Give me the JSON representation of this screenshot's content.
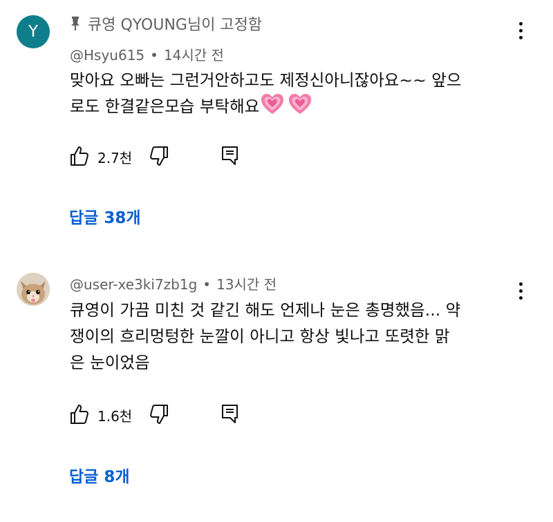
{
  "comments": [
    {
      "avatar_letter": "Y",
      "avatar_color": "#0f7e8c",
      "pinned_label": "큐영 QYOUNG님이 고정함",
      "author": "@Hsyu615",
      "separator": "•",
      "time": "14시간 전",
      "text_lines": [
        "맞아요 오빠는 그런거안하고도 제정신아니잖아요~~ 앞으",
        "로도 한결같은모습 부탁해요"
      ],
      "emoji": [
        "growing-heart",
        "growing-heart"
      ],
      "like_count": "2.7천",
      "replies_label": "답글 38개"
    },
    {
      "avatar_icon": "cat-photo-avatar",
      "author": "@user-xe3ki7zb1g",
      "separator": "•",
      "time": "13시간 전",
      "text_lines": [
        "큐영이 가끔 미친 것 같긴 해도 언제나 눈은 총명했음... 약",
        "쟁이의 흐리멍텅한 눈깔이 아니고 항상 빛나고 또렷한 맑",
        "은 눈이었음"
      ],
      "like_count": "1.6천",
      "replies_label": "답글 8개"
    }
  ],
  "colors": {
    "link": "#065fd4",
    "secondary_text": "#606060",
    "primary_text": "#0f0f0f"
  },
  "icons": [
    "pin-icon",
    "thumb-up-icon",
    "thumb-down-icon",
    "reply-icon",
    "more-vert-icon"
  ]
}
